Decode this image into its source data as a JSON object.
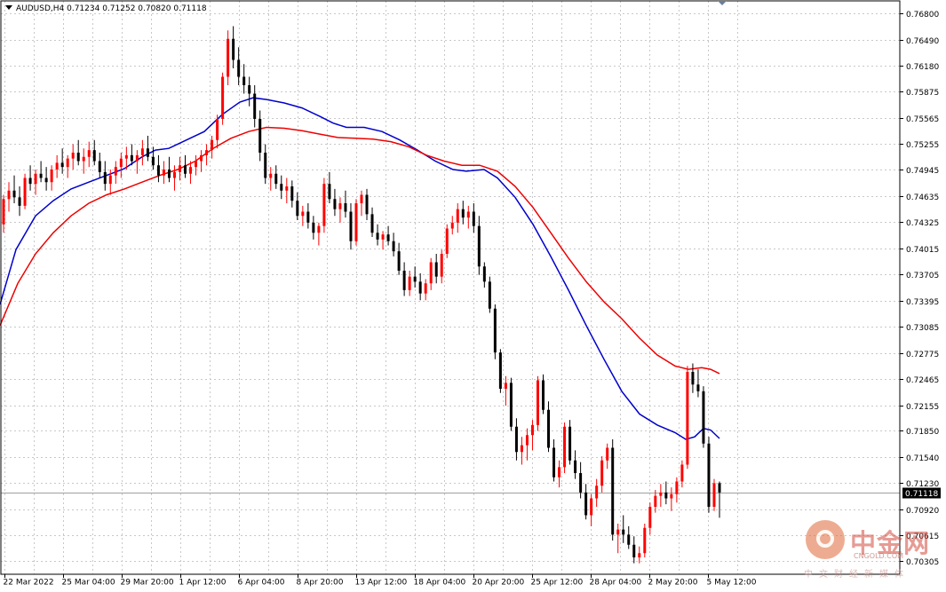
{
  "symbol_header": "AUDUSD,H4  0.71234 0.71252 0.70820 0.71118",
  "current_price_label": "0.71118",
  "watermark": {
    "brand_cn": "中金网",
    "brand_en": "CNGOLD.COM",
    "sub_cn": "中文财经新媒体"
  },
  "colors": {
    "background": "#ffffff",
    "grid": "#c8c8c8",
    "bull": "#ff0000",
    "bear": "#000000",
    "ma_fast": "#0000cc",
    "ma_slow": "#ee0000",
    "price_label_bg": "#000000",
    "price_label_text": "#ffffff"
  },
  "chart_data": {
    "type": "candlestick",
    "symbol": "AUDUSD",
    "timeframe": "H4",
    "ylim": [
      0.7015,
      0.7695
    ],
    "grid": true,
    "y_ticks": [
      "0.76800",
      "0.76490",
      "0.76180",
      "0.75875",
      "0.75565",
      "0.75255",
      "0.74945",
      "0.74635",
      "0.74325",
      "0.74015",
      "0.73705",
      "0.73395",
      "0.73085",
      "0.72775",
      "0.72465",
      "0.72155",
      "0.71850",
      "0.71540",
      "0.71230",
      "0.70920",
      "0.70615",
      "0.70305"
    ],
    "x_ticks": [
      "22 Mar 2022",
      "25 Mar 04:00",
      "29 Mar 20:00",
      "1 Apr 12:00",
      "6 Apr 04:00",
      "8 Apr 20:00",
      "13 Apr 12:00",
      "18 Apr 04:00",
      "20 Apr 20:00",
      "25 Apr 12:00",
      "28 Apr 04:00",
      "2 May 20:00",
      "5 May 12:00"
    ],
    "candles": [
      [
        0.743,
        0.7465,
        0.742,
        0.746
      ],
      [
        0.746,
        0.748,
        0.7445,
        0.747
      ],
      [
        0.747,
        0.7488,
        0.7455,
        0.7462
      ],
      [
        0.7462,
        0.7475,
        0.744,
        0.7452
      ],
      [
        0.7452,
        0.749,
        0.7448,
        0.7485
      ],
      [
        0.7485,
        0.75,
        0.747,
        0.7478
      ],
      [
        0.7478,
        0.7495,
        0.7465,
        0.749
      ],
      [
        0.749,
        0.7505,
        0.748,
        0.7485
      ],
      [
        0.7485,
        0.7498,
        0.747,
        0.748
      ],
      [
        0.748,
        0.75,
        0.747,
        0.7495
      ],
      [
        0.7495,
        0.7512,
        0.7485,
        0.7503
      ],
      [
        0.7503,
        0.752,
        0.749,
        0.7498
      ],
      [
        0.7498,
        0.7512,
        0.7485,
        0.7508
      ],
      [
        0.7508,
        0.7525,
        0.7495,
        0.7515
      ],
      [
        0.7515,
        0.753,
        0.75,
        0.7505
      ],
      [
        0.7505,
        0.752,
        0.749,
        0.751
      ],
      [
        0.751,
        0.7528,
        0.7498,
        0.7518
      ],
      [
        0.7518,
        0.753,
        0.75,
        0.7505
      ],
      [
        0.7505,
        0.7515,
        0.7485,
        0.7492
      ],
      [
        0.7492,
        0.7505,
        0.747,
        0.7478
      ],
      [
        0.7478,
        0.7495,
        0.7465,
        0.7488
      ],
      [
        0.7488,
        0.7505,
        0.7478,
        0.7498
      ],
      [
        0.7498,
        0.7515,
        0.7485,
        0.7508
      ],
      [
        0.7508,
        0.7522,
        0.7495,
        0.7512
      ],
      [
        0.7512,
        0.7525,
        0.75,
        0.7505
      ],
      [
        0.7505,
        0.7518,
        0.749,
        0.7512
      ],
      [
        0.7512,
        0.753,
        0.75,
        0.752
      ],
      [
        0.752,
        0.7535,
        0.7505,
        0.751
      ],
      [
        0.751,
        0.7522,
        0.7495,
        0.75
      ],
      [
        0.75,
        0.7512,
        0.748,
        0.7488
      ],
      [
        0.7488,
        0.7505,
        0.7478,
        0.7495
      ],
      [
        0.7495,
        0.751,
        0.748,
        0.7485
      ],
      [
        0.7485,
        0.75,
        0.747,
        0.7492
      ],
      [
        0.7492,
        0.751,
        0.7482,
        0.75
      ],
      [
        0.75,
        0.7512,
        0.7485,
        0.749
      ],
      [
        0.749,
        0.7505,
        0.7478,
        0.7498
      ],
      [
        0.7498,
        0.7512,
        0.7488,
        0.7505
      ],
      [
        0.7505,
        0.7518,
        0.7492,
        0.7512
      ],
      [
        0.7512,
        0.7525,
        0.75,
        0.7518
      ],
      [
        0.7518,
        0.7535,
        0.7508,
        0.753
      ],
      [
        0.753,
        0.756,
        0.752,
        0.7555
      ],
      [
        0.7555,
        0.761,
        0.7548,
        0.7605
      ],
      [
        0.7605,
        0.766,
        0.7595,
        0.765
      ],
      [
        0.765,
        0.7665,
        0.7615,
        0.7625
      ],
      [
        0.7625,
        0.764,
        0.7595,
        0.7605
      ],
      [
        0.7605,
        0.762,
        0.7585,
        0.7595
      ],
      [
        0.7595,
        0.7605,
        0.757,
        0.7585
      ],
      [
        0.7585,
        0.7595,
        0.7545,
        0.7555
      ],
      [
        0.7555,
        0.7565,
        0.7505,
        0.7515
      ],
      [
        0.7515,
        0.7525,
        0.7478,
        0.7485
      ],
      [
        0.7485,
        0.7498,
        0.747,
        0.749
      ],
      [
        0.749,
        0.75,
        0.7472,
        0.7478
      ],
      [
        0.7478,
        0.7488,
        0.746,
        0.747
      ],
      [
        0.747,
        0.7485,
        0.7455,
        0.7475
      ],
      [
        0.7475,
        0.7482,
        0.745,
        0.7458
      ],
      [
        0.7458,
        0.7468,
        0.7435,
        0.744
      ],
      [
        0.744,
        0.7452,
        0.7428,
        0.7445
      ],
      [
        0.7445,
        0.7455,
        0.7425,
        0.7432
      ],
      [
        0.7432,
        0.744,
        0.7412,
        0.742
      ],
      [
        0.742,
        0.7432,
        0.7405,
        0.7428
      ],
      [
        0.7428,
        0.7485,
        0.742,
        0.7478
      ],
      [
        0.7478,
        0.7492,
        0.7455,
        0.746
      ],
      [
        0.746,
        0.7472,
        0.744,
        0.7448
      ],
      [
        0.7448,
        0.7462,
        0.7432,
        0.7455
      ],
      [
        0.7455,
        0.747,
        0.7438,
        0.7445
      ],
      [
        0.7445,
        0.7455,
        0.74,
        0.741
      ],
      [
        0.741,
        0.746,
        0.7405,
        0.7455
      ],
      [
        0.7455,
        0.747,
        0.744,
        0.7465
      ],
      [
        0.7465,
        0.7472,
        0.7435,
        0.7442
      ],
      [
        0.7442,
        0.745,
        0.7415,
        0.742
      ],
      [
        0.742,
        0.743,
        0.7405,
        0.7412
      ],
      [
        0.7412,
        0.7422,
        0.74,
        0.7418
      ],
      [
        0.7418,
        0.7428,
        0.7405,
        0.741
      ],
      [
        0.741,
        0.742,
        0.7392,
        0.7398
      ],
      [
        0.7398,
        0.7408,
        0.737,
        0.7375
      ],
      [
        0.7375,
        0.7385,
        0.7345,
        0.7352
      ],
      [
        0.7352,
        0.7375,
        0.7345,
        0.7368
      ],
      [
        0.7368,
        0.738,
        0.7355,
        0.7362
      ],
      [
        0.7362,
        0.7372,
        0.734,
        0.7348
      ],
      [
        0.7348,
        0.7365,
        0.734,
        0.736
      ],
      [
        0.736,
        0.739,
        0.7352,
        0.7385
      ],
      [
        0.7385,
        0.7395,
        0.736,
        0.7368
      ],
      [
        0.7368,
        0.74,
        0.736,
        0.7395
      ],
      [
        0.7395,
        0.743,
        0.739,
        0.7425
      ],
      [
        0.7425,
        0.744,
        0.7418,
        0.7432
      ],
      [
        0.7432,
        0.7455,
        0.742,
        0.7448
      ],
      [
        0.7448,
        0.7458,
        0.743,
        0.7438
      ],
      [
        0.7438,
        0.7452,
        0.7425,
        0.7445
      ],
      [
        0.7445,
        0.7455,
        0.742,
        0.7428
      ],
      [
        0.7428,
        0.744,
        0.737,
        0.738
      ],
      [
        0.738,
        0.7385,
        0.7355,
        0.7362
      ],
      [
        0.7362,
        0.7368,
        0.7325,
        0.733
      ],
      [
        0.733,
        0.7335,
        0.727,
        0.7278
      ],
      [
        0.7278,
        0.7282,
        0.723,
        0.7235
      ],
      [
        0.7235,
        0.725,
        0.7215,
        0.7242
      ],
      [
        0.7242,
        0.7248,
        0.7185,
        0.719
      ],
      [
        0.719,
        0.72,
        0.715,
        0.716
      ],
      [
        0.716,
        0.7178,
        0.7145,
        0.7168
      ],
      [
        0.7168,
        0.7188,
        0.715,
        0.718
      ],
      [
        0.718,
        0.7198,
        0.7162,
        0.7192
      ],
      [
        0.7192,
        0.725,
        0.7185,
        0.7245
      ],
      [
        0.7245,
        0.7252,
        0.7205,
        0.721
      ],
      [
        0.721,
        0.722,
        0.716,
        0.7165
      ],
      [
        0.7165,
        0.7175,
        0.7125,
        0.713
      ],
      [
        0.713,
        0.715,
        0.7118,
        0.7142
      ],
      [
        0.7142,
        0.7195,
        0.7135,
        0.719
      ],
      [
        0.719,
        0.7198,
        0.7145,
        0.715
      ],
      [
        0.715,
        0.7162,
        0.7128,
        0.7135
      ],
      [
        0.7135,
        0.7148,
        0.7105,
        0.7112
      ],
      [
        0.7112,
        0.7122,
        0.708,
        0.7085
      ],
      [
        0.7085,
        0.711,
        0.7072,
        0.7105
      ],
      [
        0.7105,
        0.7128,
        0.7095,
        0.712
      ],
      [
        0.712,
        0.7155,
        0.7112,
        0.715
      ],
      [
        0.715,
        0.717,
        0.714,
        0.7165
      ],
      [
        0.7165,
        0.7175,
        0.7055,
        0.7062
      ],
      [
        0.7062,
        0.7075,
        0.704,
        0.7068
      ],
      [
        0.7068,
        0.7085,
        0.7052,
        0.7062
      ],
      [
        0.7062,
        0.7072,
        0.7045,
        0.705
      ],
      [
        0.705,
        0.706,
        0.7028,
        0.7035
      ],
      [
        0.7035,
        0.7048,
        0.7028,
        0.704
      ],
      [
        0.704,
        0.7075,
        0.7035,
        0.707
      ],
      [
        0.707,
        0.71,
        0.7062,
        0.7095
      ],
      [
        0.7095,
        0.7115,
        0.7088,
        0.7108
      ],
      [
        0.7108,
        0.7122,
        0.7095,
        0.7112
      ],
      [
        0.7112,
        0.7125,
        0.7098,
        0.7105
      ],
      [
        0.7105,
        0.7118,
        0.709,
        0.711
      ],
      [
        0.711,
        0.713,
        0.71,
        0.7125
      ],
      [
        0.7125,
        0.715,
        0.7118,
        0.7145
      ],
      [
        0.7145,
        0.7262,
        0.714,
        0.7255
      ],
      [
        0.7255,
        0.7265,
        0.723,
        0.724
      ],
      [
        0.724,
        0.7258,
        0.7225,
        0.7232
      ],
      [
        0.7232,
        0.7238,
        0.7165,
        0.717
      ],
      [
        0.717,
        0.7178,
        0.7088,
        0.7095
      ],
      [
        0.7095,
        0.7128,
        0.709,
        0.7123
      ],
      [
        0.7123,
        0.7125,
        0.7082,
        0.7112
      ]
    ],
    "series": [
      {
        "name": "",
        "color": "#0000cc",
        "values": [
          [
            0,
            0.7335
          ],
          [
            18,
            0.74
          ],
          [
            40,
            0.744
          ],
          [
            60,
            0.7458
          ],
          [
            80,
            0.7472
          ],
          [
            100,
            0.748
          ],
          [
            120,
            0.7488
          ],
          [
            140,
            0.7496
          ],
          [
            160,
            0.751
          ],
          [
            175,
            0.7518
          ],
          [
            190,
            0.752
          ],
          [
            210,
            0.753
          ],
          [
            230,
            0.754
          ],
          [
            250,
            0.756
          ],
          [
            270,
            0.7575
          ],
          [
            285,
            0.758
          ],
          [
            300,
            0.7578
          ],
          [
            320,
            0.7574
          ],
          [
            340,
            0.7568
          ],
          [
            360,
            0.7558
          ],
          [
            375,
            0.755
          ],
          [
            390,
            0.7545
          ],
          [
            410,
            0.7545
          ],
          [
            430,
            0.754
          ],
          [
            450,
            0.753
          ],
          [
            470,
            0.7518
          ],
          [
            490,
            0.7505
          ],
          [
            510,
            0.7495
          ],
          [
            525,
            0.7493
          ],
          [
            545,
            0.7495
          ],
          [
            560,
            0.7485
          ],
          [
            580,
            0.7462
          ],
          [
            600,
            0.743
          ],
          [
            620,
            0.7392
          ],
          [
            640,
            0.7352
          ],
          [
            660,
            0.731
          ],
          [
            680,
            0.727
          ],
          [
            700,
            0.7232
          ],
          [
            720,
            0.7205
          ],
          [
            740,
            0.7192
          ],
          [
            760,
            0.7183
          ],
          [
            772,
            0.7175
          ],
          [
            782,
            0.7178
          ],
          [
            792,
            0.7188
          ],
          [
            800,
            0.7186
          ],
          [
            810,
            0.7176
          ]
        ]
      },
      {
        "name": "",
        "color": "#ee0000",
        "values": [
          [
            0,
            0.731
          ],
          [
            20,
            0.736
          ],
          [
            40,
            0.7395
          ],
          [
            60,
            0.742
          ],
          [
            80,
            0.744
          ],
          [
            100,
            0.7455
          ],
          [
            120,
            0.7465
          ],
          [
            140,
            0.7472
          ],
          [
            160,
            0.748
          ],
          [
            180,
            0.7488
          ],
          [
            200,
            0.7495
          ],
          [
            220,
            0.7505
          ],
          [
            240,
            0.752
          ],
          [
            260,
            0.7532
          ],
          [
            280,
            0.754
          ],
          [
            300,
            0.7545
          ],
          [
            320,
            0.7544
          ],
          [
            340,
            0.7541
          ],
          [
            360,
            0.7537
          ],
          [
            380,
            0.7533
          ],
          [
            400,
            0.7532
          ],
          [
            420,
            0.7531
          ],
          [
            440,
            0.7528
          ],
          [
            460,
            0.7522
          ],
          [
            480,
            0.7512
          ],
          [
            500,
            0.7505
          ],
          [
            520,
            0.75
          ],
          [
            540,
            0.75
          ],
          [
            560,
            0.7493
          ],
          [
            580,
            0.7475
          ],
          [
            600,
            0.745
          ],
          [
            620,
            0.742
          ],
          [
            640,
            0.739
          ],
          [
            660,
            0.7362
          ],
          [
            680,
            0.7338
          ],
          [
            700,
            0.7318
          ],
          [
            720,
            0.7295
          ],
          [
            740,
            0.7275
          ],
          [
            760,
            0.7262
          ],
          [
            775,
            0.7258
          ],
          [
            790,
            0.726
          ],
          [
            800,
            0.7258
          ],
          [
            810,
            0.7253
          ]
        ]
      }
    ]
  }
}
